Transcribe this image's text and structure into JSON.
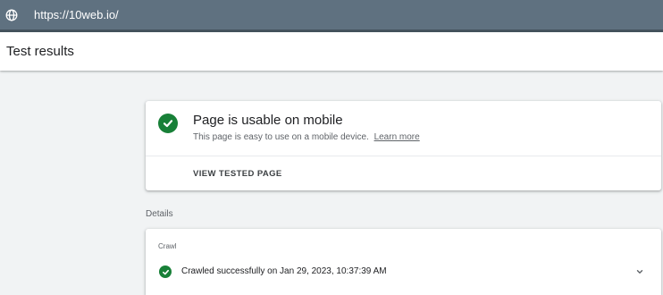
{
  "topbar": {
    "url": "https://10web.io/",
    "icon": "globe-icon"
  },
  "header": {
    "title": "Test results"
  },
  "result": {
    "title": "Page is usable on mobile",
    "description": "This page is easy to use on a mobile device.",
    "learn_more": "Learn more",
    "view_button": "VIEW TESTED PAGE",
    "status_icon": "check-circle-icon"
  },
  "details": {
    "label": "Details",
    "crawl": {
      "label": "Crawl",
      "status": "Crawled successfully on Jan 29, 2023, 10:37:39 AM",
      "status_icon": "check-circle-icon",
      "expand_icon": "chevron-down-icon"
    }
  },
  "colors": {
    "topbar": "#5f7180",
    "success": "#188038",
    "background": "#f1f3f4"
  }
}
